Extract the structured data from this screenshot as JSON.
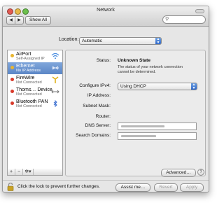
{
  "window": {
    "title": "Network"
  },
  "toolbar": {
    "back": "◀",
    "forward": "▶",
    "show_all": "Show All",
    "search_placeholder": ""
  },
  "location": {
    "label": "Location:",
    "value": "Automatic"
  },
  "services": [
    {
      "name": "AirPort",
      "status": "Self-Assigned IP",
      "dot_color": "#e8b530",
      "icon": "wifi-icon"
    },
    {
      "name": "Ethernet",
      "status": "No IP Address",
      "dot_color": "#e8b530",
      "icon": "ethernet-icon"
    },
    {
      "name": "FireWire",
      "status": "Not Connected",
      "dot_color": "#d83a2a",
      "icon": "firewire-icon"
    },
    {
      "name": "Thoms… Device",
      "status": "Not Connected",
      "dot_color": "#d83a2a",
      "icon": "device-arrows-icon"
    },
    {
      "name": "Bluetooth PAN",
      "status": "Not Connected",
      "dot_color": "#d83a2a",
      "icon": "bluetooth-icon"
    }
  ],
  "sidebar_buttons": {
    "add": "+",
    "remove": "−",
    "action": "✲▾"
  },
  "detail": {
    "status_label": "Status:",
    "status_value": "Unknown State",
    "status_description": "The status of your network connection cannot be determined.",
    "configure_ipv4_label": "Configure IPv4:",
    "configure_ipv4_value": "Using DHCP",
    "ip_label": "IP Address:",
    "subnet_label": "Subnet Mask:",
    "router_label": "Router:",
    "dns_label": "DNS Server:",
    "search_domains_label": "Search Domains:",
    "advanced_button": "Advanced…",
    "help_button": "?"
  },
  "footer": {
    "lock_text": "Click the lock to prevent further changes.",
    "assist_button": "Assist me…",
    "revert_button": "Revert",
    "apply_button": "Apply"
  },
  "colors": {
    "accent": "#2f68c9",
    "selected_row": "#5b86c6"
  }
}
